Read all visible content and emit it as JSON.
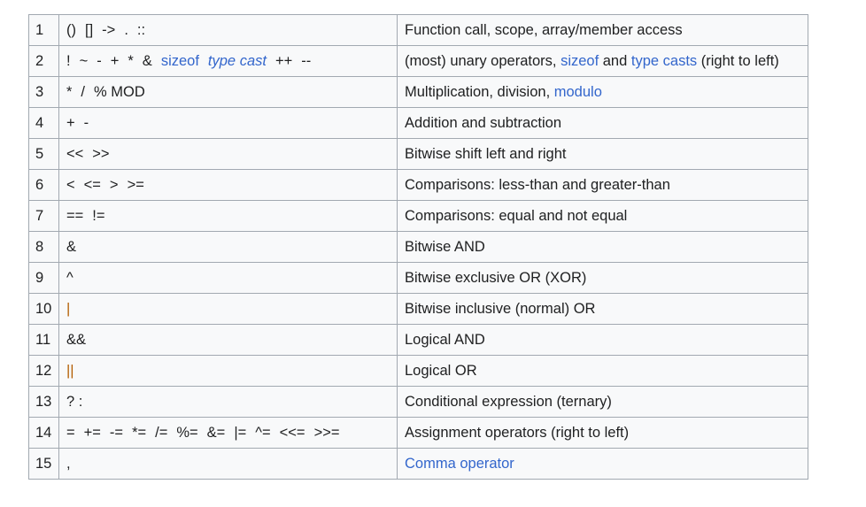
{
  "colors": {
    "link": "#3366cc",
    "pipe": "#b35d00",
    "border": "#a2a9b1",
    "background": "#f8f9fa"
  },
  "rows": [
    {
      "n": "1",
      "ops": [
        {
          "t": "()"
        },
        {
          "t": "[]"
        },
        {
          "t": "->"
        },
        {
          "t": "."
        },
        {
          "t": "::"
        }
      ],
      "desc": [
        {
          "t": "Function call, scope, array/member access"
        }
      ]
    },
    {
      "n": "2",
      "ops": [
        {
          "t": "!"
        },
        {
          "t": "~"
        },
        {
          "t": "-"
        },
        {
          "t": "+"
        },
        {
          "t": "*"
        },
        {
          "t": "&"
        },
        {
          "t": "sizeof",
          "s": "link"
        },
        {
          "t": "type cast",
          "s": "link ital"
        },
        {
          "t": "++"
        },
        {
          "t": "--"
        }
      ],
      "desc": [
        {
          "t": "(most) unary operators, "
        },
        {
          "t": "sizeof",
          "s": "link"
        },
        {
          "t": " and "
        },
        {
          "t": "type casts",
          "s": "link"
        },
        {
          "t": " (right to left)"
        }
      ]
    },
    {
      "n": "3",
      "ops": [
        {
          "t": "*"
        },
        {
          "t": "/"
        },
        {
          "t": "% MOD"
        }
      ],
      "desc": [
        {
          "t": "Multiplication, division, "
        },
        {
          "t": "modulo",
          "s": "link"
        }
      ]
    },
    {
      "n": "4",
      "ops": [
        {
          "t": "+"
        },
        {
          "t": "-"
        }
      ],
      "desc": [
        {
          "t": "Addition and subtraction"
        }
      ]
    },
    {
      "n": "5",
      "ops": [
        {
          "t": "<<"
        },
        {
          "t": ">>"
        }
      ],
      "desc": [
        {
          "t": "Bitwise shift left and right"
        }
      ]
    },
    {
      "n": "6",
      "ops": [
        {
          "t": "<"
        },
        {
          "t": "<="
        },
        {
          "t": ">"
        },
        {
          "t": ">="
        }
      ],
      "desc": [
        {
          "t": "Comparisons: less-than and greater-than"
        }
      ]
    },
    {
      "n": "7",
      "ops": [
        {
          "t": "=="
        },
        {
          "t": "!="
        }
      ],
      "desc": [
        {
          "t": "Comparisons: equal and not equal"
        }
      ]
    },
    {
      "n": "8",
      "ops": [
        {
          "t": "&"
        }
      ],
      "desc": [
        {
          "t": "Bitwise AND"
        }
      ]
    },
    {
      "n": "9",
      "ops": [
        {
          "t": "^"
        }
      ],
      "desc": [
        {
          "t": "Bitwise exclusive OR (XOR)"
        }
      ]
    },
    {
      "n": "10",
      "ops": [
        {
          "t": "|",
          "s": "pipe"
        }
      ],
      "desc": [
        {
          "t": "Bitwise inclusive (normal) OR"
        }
      ]
    },
    {
      "n": "11",
      "ops": [
        {
          "t": "&&"
        }
      ],
      "desc": [
        {
          "t": "Logical AND"
        }
      ]
    },
    {
      "n": "12",
      "ops": [
        {
          "t": "||",
          "s": "pipe"
        }
      ],
      "desc": [
        {
          "t": "Logical OR"
        }
      ]
    },
    {
      "n": "13",
      "ops": [
        {
          "t": "? :"
        }
      ],
      "desc": [
        {
          "t": "Conditional expression (ternary)"
        }
      ]
    },
    {
      "n": "14",
      "ops": [
        {
          "t": "="
        },
        {
          "t": "+="
        },
        {
          "t": "-="
        },
        {
          "t": "*="
        },
        {
          "t": "/="
        },
        {
          "t": "%="
        },
        {
          "t": "&="
        },
        {
          "t": "|="
        },
        {
          "t": "^="
        },
        {
          "t": "<<="
        },
        {
          "t": ">>="
        }
      ],
      "desc": [
        {
          "t": "Assignment operators (right to left)"
        }
      ]
    },
    {
      "n": "15",
      "ops": [
        {
          "t": ","
        }
      ],
      "desc": [
        {
          "t": "Comma operator",
          "s": "link"
        }
      ]
    }
  ]
}
